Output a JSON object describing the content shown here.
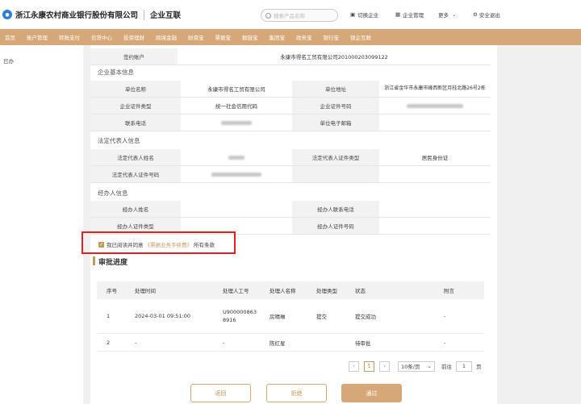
{
  "header": {
    "bank_name": "浙江永康农村商业银行股份有限公司",
    "product_name": "企业互联",
    "search_placeholder": "搜索产品名称",
    "switch_company": "切换企业",
    "company_manage": "企业管理",
    "more": "更多",
    "logout": "安全退出"
  },
  "nav": {
    "items": [
      "首页",
      "账户管理",
      "转账支付",
      "信贷中心",
      "投资理财",
      "跨境金融",
      "财资宝",
      "票据宝",
      "数链宝",
      "集团宝",
      "政务宝",
      "银行宝",
      "银企互联"
    ]
  },
  "sidebar": {
    "item": "已办"
  },
  "form": {
    "signing_account_label": "签约账户",
    "signing_account_value": "永康市得名工贸有限公司201000203099122",
    "section_enterprise": "企业基本信息",
    "unit_name_label": "单位名称",
    "unit_name_value": "永康市得名工贸有限公司",
    "unit_address_label": "单位地址",
    "unit_address_value": "浙江省金华市永康市峰西新区月桂北路26号2栋",
    "cert_type_label": "企业证件类型",
    "cert_type_value": "统一社会信用代码",
    "cert_no_label": "企业证件号码",
    "phone_label": "联系电话",
    "email_label": "单位电子邮箱",
    "section_legal": "法定代表人信息",
    "legal_name_label": "法定代表人姓名",
    "legal_cert_type_label": "法定代表人证件类型",
    "legal_cert_type_value": "居民身份证",
    "legal_cert_no_label": "法定代表人证件号码",
    "section_agent": "经办人信息",
    "agent_name_label": "经办人姓名",
    "agent_phone_label": "经办人联系电话",
    "agent_cert_type_label": "经办人证件类型",
    "agent_cert_no_label": "经办人证件号码"
  },
  "agreement": {
    "prefix": "我已阅读并同意",
    "link": "《票据业务手续费》",
    "suffix": "所有条款"
  },
  "approval": {
    "title": "审批进度",
    "columns": [
      "序号",
      "处理时间",
      "处理人工号",
      "处理人名称",
      "处理类型",
      "状态",
      "附言"
    ],
    "rows": [
      {
        "no": "1",
        "time": "2024-03-01 09:51:00",
        "staff_no": "U9000008638916",
        "staff_name": "房晴琳",
        "type": "提交",
        "status": "提交成功",
        "note": "-"
      },
      {
        "no": "2",
        "time": "-",
        "staff_no": "-",
        "staff_name": "陈红星",
        "type": "",
        "status": "待审批",
        "note": "-"
      }
    ]
  },
  "pager": {
    "current_page": "1",
    "page_size": "10条/页",
    "goto_label": "前往",
    "goto_value": "1",
    "page_unit": "页"
  },
  "buttons": {
    "back": "返回",
    "reject": "拒绝",
    "approve": "通过"
  },
  "colors": {
    "nav_bg": "#d6a877",
    "accent": "#c39a5d",
    "highlight_border": "#e02020"
  }
}
